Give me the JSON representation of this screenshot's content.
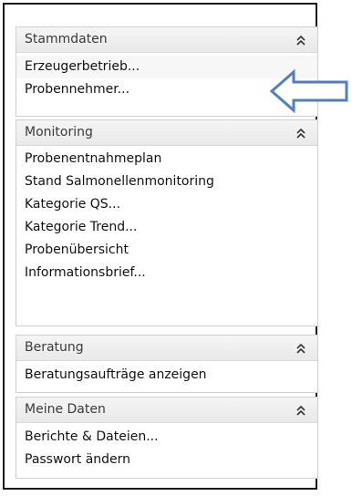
{
  "panels": [
    {
      "title": "Stammdaten",
      "items": [
        "Erzeugerbetrieb...",
        "Probennehmer..."
      ]
    },
    {
      "title": "Monitoring",
      "items": [
        "Probenentnahmeplan",
        "Stand Salmonellenmonitoring",
        "Kategorie QS...",
        "Kategorie Trend...",
        "Probenübersicht",
        "Informationsbrief..."
      ]
    },
    {
      "title": "Beratung",
      "items": [
        "Beratungsaufträge anzeigen"
      ]
    },
    {
      "title": "Meine Daten",
      "items": [
        "Berichte & Dateien...",
        "Passwort ändern"
      ]
    }
  ],
  "icons": {
    "collapse": "double-chevron-up-icon",
    "annotation": "left-arrow-icon"
  },
  "colors": {
    "arrow_fill": "#ffffff",
    "arrow_stroke": "#4f7ec2",
    "panel_border": "#cfcfcf",
    "header_bg": "#ececec"
  }
}
